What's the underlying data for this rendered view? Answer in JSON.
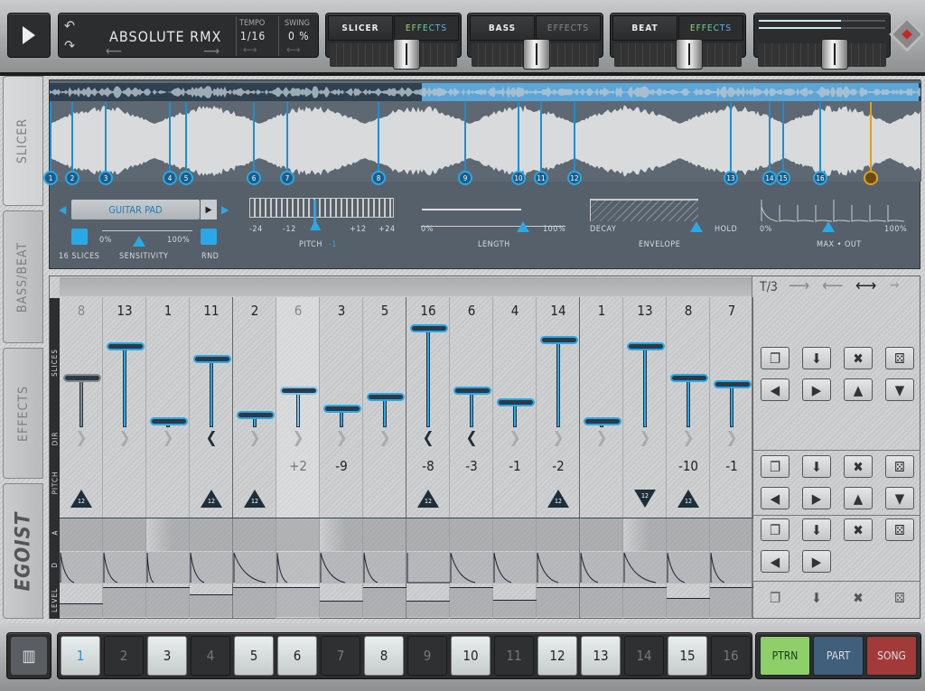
{
  "transport": {
    "play_icon": "play-icon"
  },
  "song": {
    "title": "ABSOLUTE RMX",
    "tempo_label": "TEMPO",
    "tempo_value": "1/16",
    "swing_label": "SWING",
    "swing_value": "0 %"
  },
  "channels": [
    {
      "name": "SLICER",
      "effects_label": "EFFECTS",
      "effects_active": true,
      "fader": 0.62
    },
    {
      "name": "BASS",
      "effects_label": "EFFECTS",
      "effects_active": false,
      "fader": 0.5
    },
    {
      "name": "BEAT",
      "effects_label": "EFFECTS",
      "effects_active": true,
      "fader": 0.6
    }
  ],
  "master": {
    "level_l": 0.65,
    "level_r": 0.65,
    "fader": 0.6
  },
  "side_tabs": [
    {
      "label": "SLICER",
      "active": true
    },
    {
      "label": "BASS/BEAT",
      "active": false
    },
    {
      "label": "EFFECTS",
      "active": false
    }
  ],
  "logo": "EGOIST",
  "slicer": {
    "markers": [
      "1",
      "2",
      "3",
      "4",
      "5",
      "6",
      "7",
      "8",
      "9",
      "10",
      "11",
      "12",
      "13",
      "14",
      "15",
      "16"
    ],
    "sample_name": "GUITAR PAD",
    "slices_label": "16 SLICES",
    "sensitivity": {
      "label": "SENSITIVITY",
      "min": "0%",
      "max": "100%",
      "value": 0.35
    },
    "rnd_label": "RND",
    "pitch": {
      "label": "PITCH",
      "value": "-1",
      "ticks": [
        "-24",
        "-12",
        "+12",
        "+24"
      ]
    },
    "length": {
      "label": "LENGTH",
      "min": "0%",
      "max": "100%",
      "value": 0.8
    },
    "envelope": {
      "label": "ENVELOPE",
      "min": "DECAY",
      "max": "HOLD",
      "value": 0.7
    },
    "maxout": {
      "label": "MAX • OUT",
      "min": "0%",
      "max": "100%",
      "value": 0.4
    }
  },
  "grid": {
    "row_labels": {
      "slices": "SLICES",
      "dir": "DIR",
      "pitch": "PITCH",
      "a": "A",
      "d": "D",
      "level": "LEVEL"
    },
    "triplet_label": "T/3",
    "steps": [
      {
        "slice": "8",
        "dim": "gray",
        "dir": "fwd",
        "pitch": "",
        "oct": "up",
        "attack": 0,
        "decay": 0.3,
        "level": 0.25
      },
      {
        "slice": "13",
        "dir": "fwd",
        "pitch": "",
        "oct": "",
        "attack": 0,
        "decay": 0.3,
        "level": 0.9
      },
      {
        "slice": "1",
        "dir": "fwd",
        "pitch": "",
        "oct": "",
        "attack": 1,
        "decay": 0.1,
        "level": 0.9
      },
      {
        "slice": "11",
        "dir": "rev",
        "pitch": "",
        "oct": "up",
        "attack": 0,
        "decay": 0.3,
        "level": 0.6
      },
      {
        "slice": "2",
        "dir": "fwd",
        "pitch": "",
        "oct": "up",
        "attack": 0,
        "decay": 0.8,
        "level": 0.9
      },
      {
        "slice": "6",
        "dim": "light",
        "dir": "fwd",
        "pitch": "+2",
        "oct": "",
        "attack": 0,
        "decay": 0.2,
        "level": 0.9
      },
      {
        "slice": "3",
        "dir": "fwd",
        "pitch": "-9",
        "oct": "",
        "attack": 1,
        "decay": 0.6,
        "level": 0.35
      },
      {
        "slice": "5",
        "dir": "fwd",
        "pitch": "",
        "oct": "",
        "attack": 0,
        "decay": 0.3,
        "level": 0.9
      },
      {
        "slice": "16",
        "dir": "rev",
        "pitch": "-8",
        "oct": "up",
        "attack": 0,
        "decay": 0,
        "level": 0.35
      },
      {
        "slice": "6",
        "dir": "rev",
        "pitch": "-3",
        "oct": "",
        "attack": 0,
        "decay": 0.6,
        "level": 0.9
      },
      {
        "slice": "4",
        "dir": "fwd",
        "pitch": "-1",
        "oct": "",
        "attack": 0,
        "decay": 0.4,
        "level": 0.4
      },
      {
        "slice": "14",
        "dir": "fwd",
        "pitch": "-2",
        "oct": "up",
        "attack": 0,
        "decay": 0.5,
        "level": 0.9
      },
      {
        "slice": "1",
        "dir": "fwd",
        "pitch": "",
        "oct": "",
        "attack": 0,
        "decay": 0.4,
        "level": 0.9
      },
      {
        "slice": "13",
        "dir": "fwd",
        "pitch": "",
        "oct": "down",
        "attack": 1,
        "decay": 0.8,
        "level": 0.9
      },
      {
        "slice": "8",
        "dir": "fwd",
        "pitch": "-10",
        "oct": "up",
        "attack": 0,
        "decay": 0.4,
        "level": 0.45
      },
      {
        "slice": "7",
        "dir": "fwd",
        "pitch": "-1",
        "oct": "",
        "attack": 0,
        "decay": 0.3,
        "level": 0.9
      }
    ],
    "octave_label": "12"
  },
  "pattern_steps": [
    {
      "label": "1",
      "on": true,
      "current": true
    },
    {
      "label": "2",
      "on": false
    },
    {
      "label": "3",
      "on": true
    },
    {
      "label": "4",
      "on": false
    },
    {
      "label": "5",
      "on": true
    },
    {
      "label": "6",
      "on": true
    },
    {
      "label": "7",
      "on": false
    },
    {
      "label": "8",
      "on": true
    },
    {
      "label": "9",
      "on": false
    },
    {
      "label": "10",
      "on": true
    },
    {
      "label": "11",
      "on": false
    },
    {
      "label": "12",
      "on": true
    },
    {
      "label": "13",
      "on": true
    },
    {
      "label": "14",
      "on": false
    },
    {
      "label": "15",
      "on": true
    },
    {
      "label": "16",
      "on": false
    }
  ],
  "modes": [
    {
      "label": "PTRN",
      "color": "#8fcf6a",
      "active": true
    },
    {
      "label": "PART",
      "color": "#3f5f7a",
      "active": false
    },
    {
      "label": "SONG",
      "color": "#a33a3a",
      "active": false
    }
  ],
  "colors": {
    "accent": "#2aa8e6",
    "marker": "#1e8fd0",
    "end_marker": "#e0a020"
  }
}
